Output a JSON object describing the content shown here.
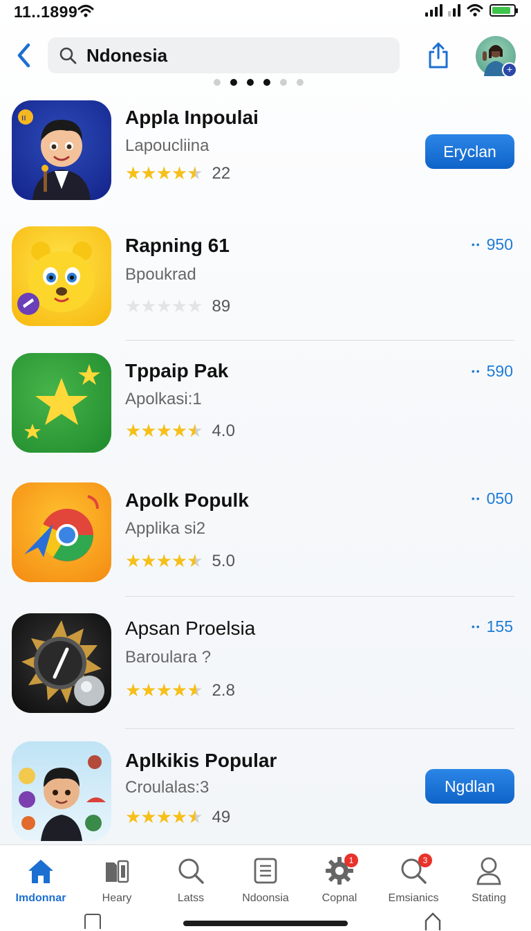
{
  "status": {
    "time": "11..1899"
  },
  "search": {
    "query": "Ndonesia"
  },
  "apps": [
    {
      "title": "Appla Inpoulai",
      "subtitle": "Lapoucliina",
      "rating_count": "22",
      "stars": 4.5,
      "action": "Eryclan"
    },
    {
      "title": "Rapning 61",
      "subtitle": "Bpoukrad",
      "rating_count": "89",
      "stars": 0,
      "price": "950"
    },
    {
      "title": "Tppaip Pak",
      "subtitle": "Apolkasi:1",
      "rating_count": "4.0",
      "stars": 4.5,
      "price": "590"
    },
    {
      "title": "Apolk Populk",
      "subtitle": "Applika si2",
      "rating_count": "5.0",
      "stars": 4.5,
      "price": "050"
    },
    {
      "title": "Apsan Proelsia",
      "subtitle": "Baroulara ?",
      "rating_count": "2.8",
      "stars": 4.5,
      "price": "155"
    },
    {
      "title": "Aplkikis Popular",
      "subtitle": "Croulalas:3",
      "rating_count": "49",
      "stars": 4.5,
      "action": "Ngdlan"
    }
  ],
  "tabs": [
    {
      "label": "Imdonnar",
      "icon": "home-icon"
    },
    {
      "label": "Heary",
      "icon": "apps-icon"
    },
    {
      "label": "Latss",
      "icon": "search-icon"
    },
    {
      "label": "Ndoonsia",
      "icon": "document-icon"
    },
    {
      "label": "Copnal",
      "icon": "gear-icon",
      "badge": "1"
    },
    {
      "label": "Emsianics",
      "icon": "search-icon",
      "badge": "3"
    },
    {
      "label": "Stating",
      "icon": "person-icon"
    }
  ],
  "colors": {
    "accent": "#1c6fd1",
    "star": "#f6bf1a",
    "badge": "#e8322b"
  }
}
